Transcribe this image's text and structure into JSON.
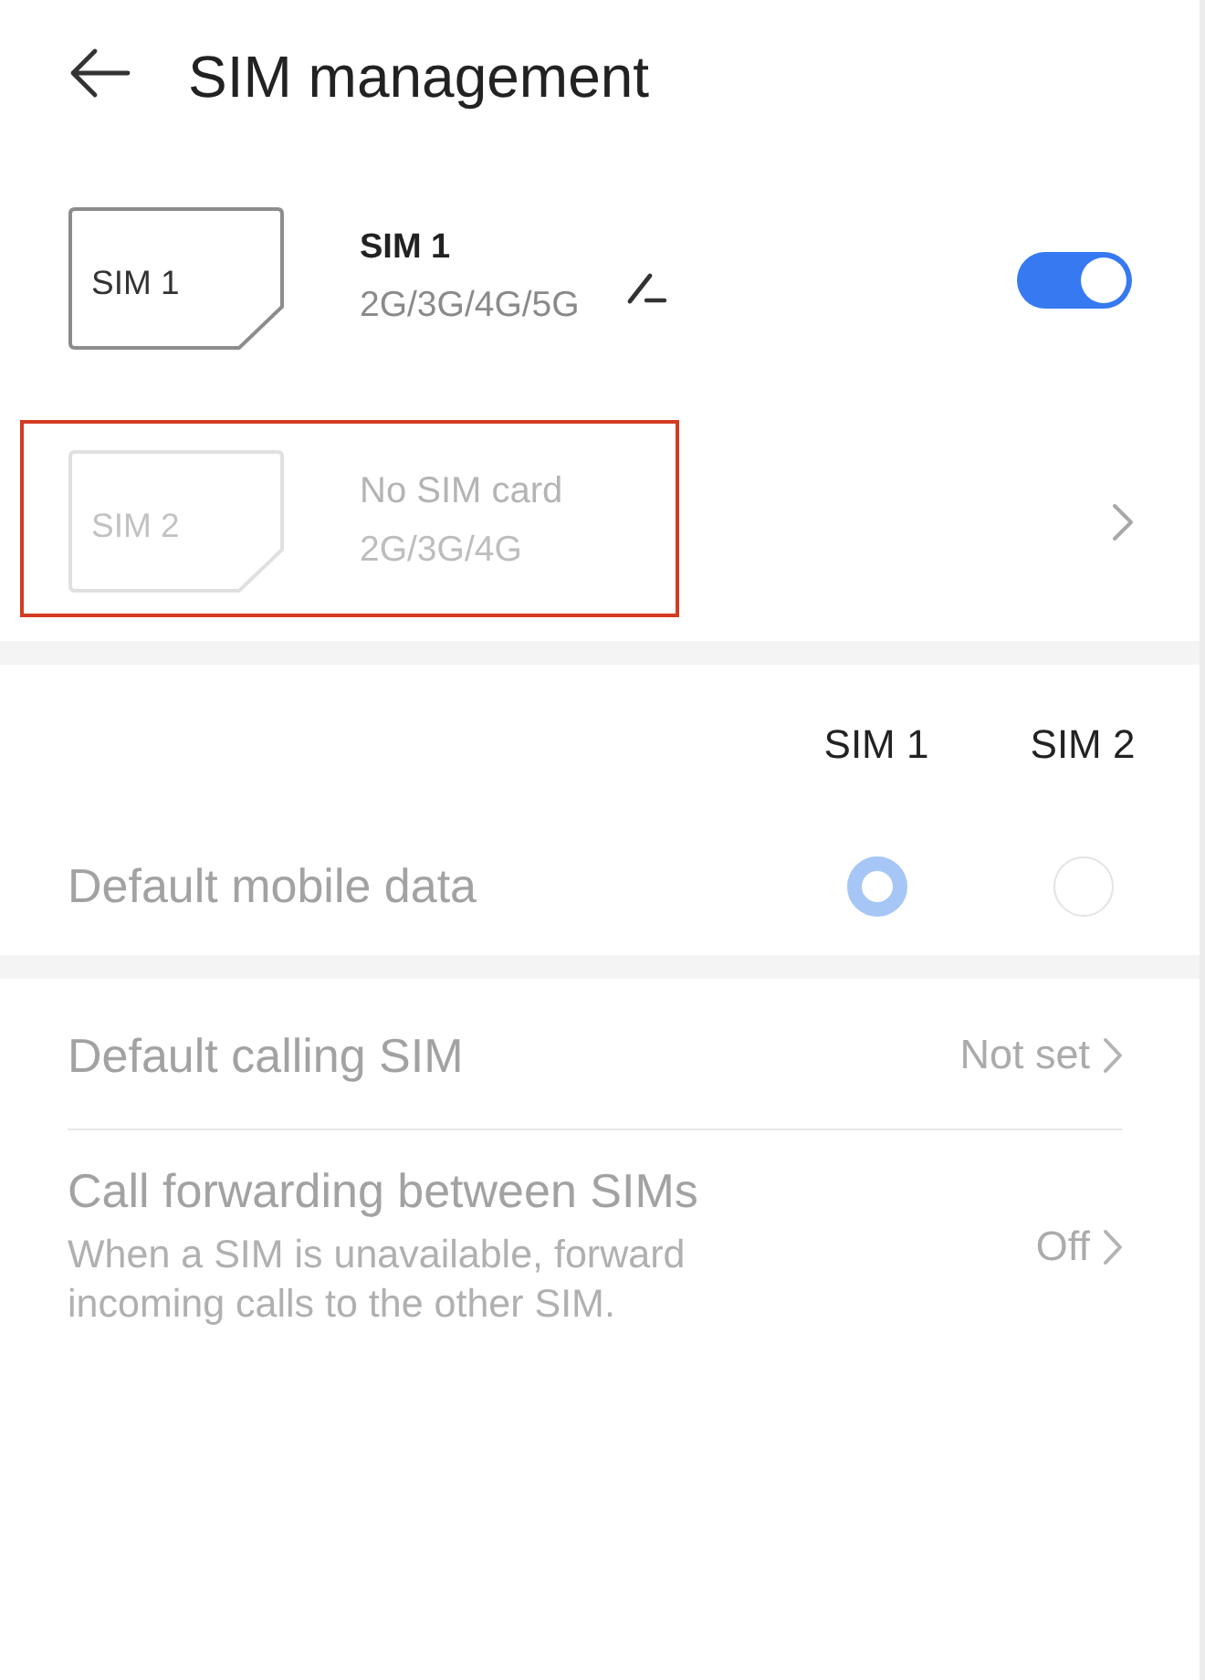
{
  "header": {
    "title": "SIM management"
  },
  "sims": [
    {
      "kind": "toggle",
      "card_label": "SIM 1",
      "name": "SIM 1",
      "networks": "2G/3G/4G/5G",
      "disabled": false,
      "editable": true,
      "highlighted": false,
      "on": true
    },
    {
      "kind": "chevron",
      "card_label": "SIM 2",
      "name": "No SIM card",
      "networks": "2G/3G/4G",
      "disabled": true,
      "editable": false,
      "highlighted": true
    }
  ],
  "default_data": {
    "columns": [
      "SIM 1",
      "SIM 2"
    ],
    "label": "Default mobile data",
    "disabled": true,
    "options": [
      {
        "selected": true
      },
      {
        "selected": false
      }
    ]
  },
  "settings": [
    {
      "title": "Default calling SIM",
      "value": "Not set",
      "disabled": true
    },
    {
      "title": "Call forwarding between SIMs",
      "description": "When a SIM is unavailable, forward incoming calls to the other SIM.",
      "value": "Off",
      "disabled": true
    }
  ]
}
